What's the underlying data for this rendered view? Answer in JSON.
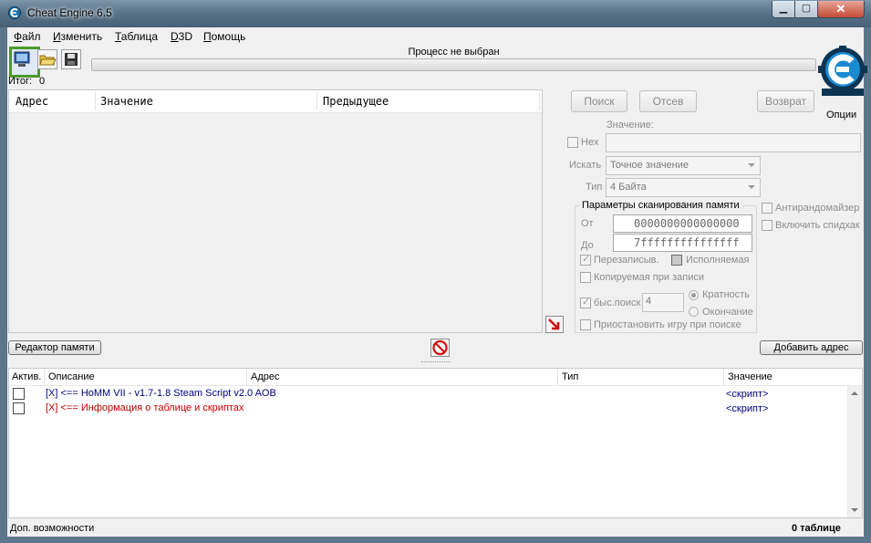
{
  "window": {
    "title": "Cheat Engine 6.5"
  },
  "menu": [
    "Файл",
    "Изменить",
    "Таблица",
    "D3D",
    "Помощь"
  ],
  "toolbar": {
    "process_label": "Процесс не выбран",
    "options_label": "Опции"
  },
  "found": {
    "label": "Итог:",
    "value": "0"
  },
  "results": {
    "columns": [
      "Адрес",
      "Значение",
      "Предыдущее"
    ]
  },
  "scan": {
    "first_scan": "Поиск",
    "next_scan": "Отсев",
    "undo_scan": "Возврат",
    "value_label": "Значение:",
    "hex_label": "Hex",
    "scan_type_label": "Искать",
    "scan_type": "Точное значение",
    "value_type_label": "Тип",
    "value_type": "4 Байта",
    "memory_group_title": "Параметры сканирования памяти",
    "from_label": "От",
    "from_value": "0000000000000000",
    "to_label": "До",
    "to_value": "7fffffffffffffff",
    "writable_label": "Перезаписыв.",
    "executable_label": "Исполняемая",
    "copy_on_write_label": "Копируемая при записи",
    "fast_scan_label": "быс.поиск",
    "fast_scan_value": "4",
    "alignment_label": "Кратность",
    "last_digits_label": "Окончание",
    "pause_game_label": "Приостановить игру при поиске",
    "unrandomizer_label": "Антирандомайзер",
    "speedhack_label": "Включить спидхак"
  },
  "bottom_buttons": {
    "memory_view": "Редактор памяти",
    "add_address": "Добавить адрес"
  },
  "address_list": {
    "columns": [
      "Актив.",
      "Описание",
      "Адрес",
      "Тип",
      "Значение"
    ],
    "rows": [
      {
        "description": "[X] <== HoMM VII - v1.7-1.8 Steam Script v2.0 AOB",
        "value": "<скрипт>",
        "color": "#00007f"
      },
      {
        "description": "[X] <== Информация о таблице и скриптах",
        "value": "<скрипт>",
        "color": "#c00000"
      }
    ]
  },
  "status": {
    "left": "Доп. возможности",
    "right": "0 таблице"
  },
  "colors": {
    "titlebar": "#5a748a",
    "process_button_border": "#4a9a2a",
    "row_blue": "#00007f",
    "row_red": "#c00000"
  }
}
